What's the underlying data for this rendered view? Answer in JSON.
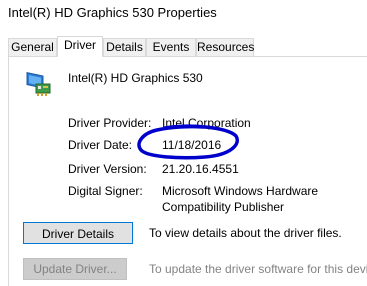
{
  "window": {
    "title": "Intel(R) HD Graphics 530 Properties"
  },
  "tabs": [
    {
      "label": "General",
      "active": false
    },
    {
      "label": "Driver",
      "active": true
    },
    {
      "label": "Details",
      "active": false
    },
    {
      "label": "Events",
      "active": false
    },
    {
      "label": "Resources",
      "active": false
    }
  ],
  "device": {
    "icon": "display-adapter-icon",
    "name": "Intel(R) HD Graphics 530"
  },
  "fields": {
    "provider": {
      "label": "Driver Provider:",
      "value": "Intel Corporation"
    },
    "date": {
      "label": "Driver Date:",
      "value": "11/18/2016"
    },
    "version": {
      "label": "Driver Version:",
      "value": "21.20.16.4551"
    },
    "signer": {
      "label": "Digital Signer:",
      "value": "Microsoft Windows Hardware Compatibility Publisher"
    }
  },
  "actions": {
    "details": {
      "button": "Driver Details",
      "description": "To view details about the driver files."
    },
    "update": {
      "button": "Update Driver...",
      "description": "To update the driver software for this device."
    }
  },
  "colors": {
    "annotation_circle": "#0000cc",
    "focus_border": "#0078d7",
    "disabled_text": "#838383"
  }
}
